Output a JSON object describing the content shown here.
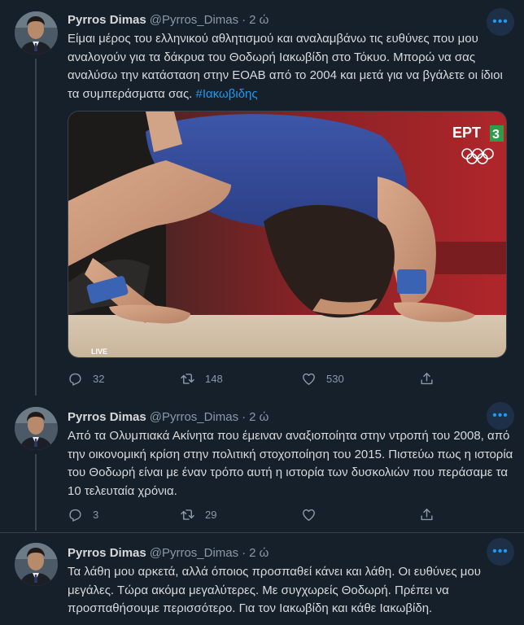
{
  "tweets": [
    {
      "name": "Pyrros Dimas",
      "handle": "@Pyrros_Dimas",
      "sep": "·",
      "time": "2 ώ",
      "text": "Είμαι μέρος του ελληνικού αθλητισμού και αναλαμβάνω τις ευθύνες που μου αναλογούν για τα δάκρυα του Θοδωρή Ιακωβίδη στο Τόκυο. Μπορώ να σας αναλύσω την κατάσταση στην ΕΟΑΒ από το 2004 και μετά για να βγάλετε οι ίδιοι τα συμπεράσματα σας.",
      "hashtag": "#Ιακωβιδης",
      "media": {
        "channel": "ΕΡΤ",
        "channel_number": "3",
        "live": "LIVE"
      },
      "replies": "32",
      "retweets": "148",
      "likes": "530"
    },
    {
      "name": "Pyrros Dimas",
      "handle": "@Pyrros_Dimas",
      "sep": "·",
      "time": "2 ώ",
      "text": "Από τα Ολυμπιακά Ακίνητα που έμειναν αναξιοποίητα στην ντροπή του 2008, από την οικονομική κρίση στην πολιτική στοχοποίηση του 2015. Πιστεύω πως η ιστορία του Θοδωρή είναι με έναν τρόπο αυτή η ιστορία των δυσκολιών που περάσαμε τα 10 τελευταία χρόνια.",
      "replies": "3",
      "retweets": "29",
      "likes": ""
    },
    {
      "name": "Pyrros Dimas",
      "handle": "@Pyrros_Dimas",
      "sep": "·",
      "time": "2 ώ",
      "text": "Τα λάθη μου αρκετά, αλλά όποιος προσπαθεί κάνει και λάθη.  Οι ευθύνες μου μεγάλες. Τώρα ακόμα μεγαλύτερες. Με συγχωρείς Θοδωρή. Πρέπει να προσπαθήσουμε περισσότερο. Για τον Ιακωβίδη και κάθε Ιακωβίδη."
    }
  ],
  "icons": {
    "more": "more-icon",
    "reply": "reply-icon",
    "retweet": "retweet-icon",
    "like": "like-icon",
    "share": "share-icon"
  },
  "colors": {
    "background": "#15202b",
    "accent": "#1d9bf0",
    "muted": "#8b98a5",
    "border": "#38444d"
  }
}
